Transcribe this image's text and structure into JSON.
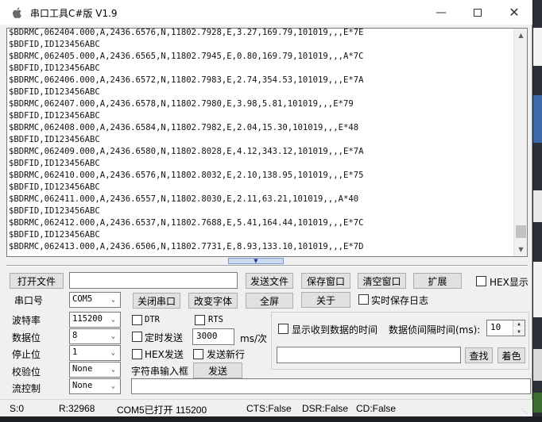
{
  "window": {
    "title": "串口工具C#版  V1.9"
  },
  "console": {
    "lines": [
      "$BDRMC,062404.000,A,2436.6576,N,11802.7928,E,3.27,169.79,101019,,,E*7E",
      "$BDFID,ID123456ABC",
      "$BDRMC,062405.000,A,2436.6565,N,11802.7945,E,0.80,169.79,101019,,,A*7C",
      "$BDFID,ID123456ABC",
      "$BDRMC,062406.000,A,2436.6572,N,11802.7983,E,2.74,354.53,101019,,,E*7A",
      "$BDFID,ID123456ABC",
      "$BDRMC,062407.000,A,2436.6578,N,11802.7980,E,3.98,5.81,101019,,,E*79",
      "$BDFID,ID123456ABC",
      "$BDRMC,062408.000,A,2436.6584,N,11802.7982,E,2.04,15.30,101019,,,E*48",
      "$BDFID,ID123456ABC",
      "$BDRMC,062409.000,A,2436.6580,N,11802.8028,E,4.12,343.12,101019,,,E*7A",
      "$BDFID,ID123456ABC",
      "$BDRMC,062410.000,A,2436.6576,N,11802.8032,E,2.10,138.95,101019,,,E*75",
      "$BDFID,ID123456ABC",
      "$BDRMC,062411.000,A,2436.6557,N,11802.8030,E,2.11,63.21,101019,,,A*40",
      "$BDFID,ID123456ABC",
      "$BDRMC,062412.000,A,2436.6537,N,11802.7688,E,5.41,164.44,101019,,,E*7C",
      "$BDFID,ID123456ABC",
      "$BDRMC,062413.000,A,2436.6506,N,11802.7731,E,8.93,133.10,101019,,,E*7D"
    ]
  },
  "toolbar": {
    "open_file": "打开文件",
    "file_path": "",
    "send_file": "发送文件",
    "save_window": "保存窗口",
    "clear_window": "清空窗口",
    "expand": "扩展",
    "hex_display": "HEX显示",
    "port_label": "串口号",
    "port_value": "COM5",
    "close_port": "关闭串口",
    "change_font": "改变字体",
    "fullscreen": "全屏",
    "about": "关于",
    "realtime_save": "实时保存日志"
  },
  "settings": {
    "baud_label": "波特率",
    "baud_value": "115200",
    "databits_label": "数据位",
    "databits_value": "8",
    "stopbits_label": "停止位",
    "stopbits_value": "1",
    "parity_label": "校验位",
    "parity_value": "None",
    "flow_label": "流控制",
    "flow_value": "None"
  },
  "send": {
    "dtr": "DTR",
    "rts": "RTS",
    "timed_send": "定时发送",
    "interval_value": "3000",
    "interval_unit": "ms/次",
    "hex_send": "HEX发送",
    "send_newline": "发送新行",
    "input_label": "字符串输入框",
    "send_button": "发送",
    "input_value": ""
  },
  "extension": {
    "show_time": "显示收到数据的时间",
    "frame_gap_label": "数据侦间隔时间(ms):",
    "frame_gap_value": "10",
    "search_value": "",
    "find_button": "查找",
    "color_button": "着色"
  },
  "status": {
    "s": "S:0",
    "r": "R:32968",
    "port_state": "COM5已打开  115200",
    "cts": "CTS:False",
    "dsr": "DSR:False",
    "cd": "CD:False"
  }
}
